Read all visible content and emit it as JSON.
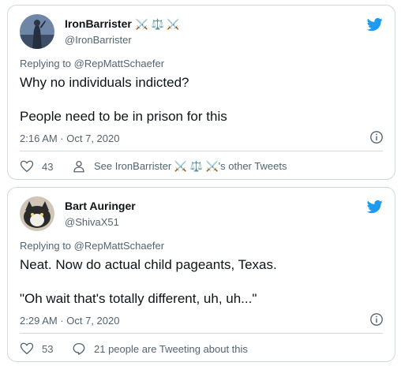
{
  "tweets": [
    {
      "author_name": "IronBarrister",
      "author_emoji": "⚔️ ⚖️ ⚔️",
      "handle": "@IronBarrister",
      "replying_prefix": "Replying to",
      "replying_handle": "@RepMattSchaefer",
      "lines": [
        "Why no individuals indicted?",
        "People need to be in prison for this"
      ],
      "timestamp": "2:16 AM · Oct 7, 2020",
      "like_count": "43",
      "action_text": "See IronBarrister ⚔️ ⚖️ ⚔️'s other Tweets",
      "action_icon": "person-icon",
      "avatar_colors": [
        "#5a7394",
        "#2e3b52"
      ]
    },
    {
      "author_name": "Bart Auringer",
      "author_emoji": "",
      "handle": "@ShivaX51",
      "replying_prefix": "Replying to",
      "replying_handle": "@RepMattSchaefer",
      "lines": [
        "Neat.  Now do actual child pageants, Texas.",
        "\"Oh wait that's totally different, uh, uh...\""
      ],
      "timestamp": "2:29 AM · Oct 7, 2020",
      "like_count": "53",
      "action_text": "21 people are Tweeting about this",
      "action_icon": "speech-bubble-icon",
      "avatar_colors": [
        "#3a3a3a",
        "#e8e2d8"
      ]
    }
  ],
  "colors": {
    "twitter_blue": "#1d9bf0",
    "secondary_text": "#536471",
    "border": "#cfd9de"
  }
}
